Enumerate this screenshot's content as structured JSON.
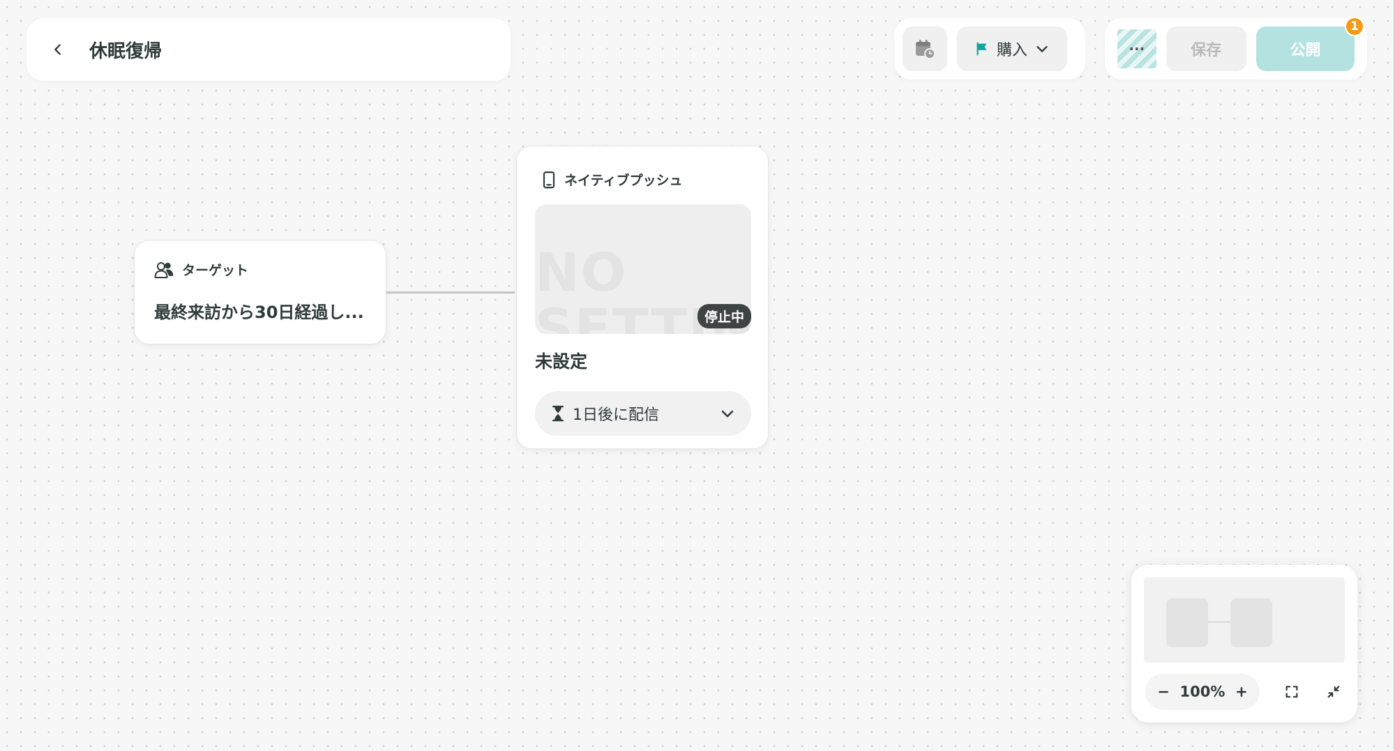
{
  "header": {
    "back_icon": "chevron-left-icon",
    "title": "休眠復帰"
  },
  "toolbar": {
    "schedule_icon": "calendar-clock-icon",
    "goal_icon": "flag-icon",
    "goal_label": "購入",
    "more_label": "···",
    "save_label": "保存",
    "publish_label": "公開",
    "notification_count": "1"
  },
  "target_node": {
    "icon": "users-icon",
    "label": "ターゲット",
    "condition": "最終来訪から30日経過し..."
  },
  "push_node": {
    "icon": "smartphone-icon",
    "label": "ネイティブプッシュ",
    "preview_watermark": "NO\nSETTING",
    "status": "停止中",
    "title": "未設定",
    "delivery_icon": "hourglass-icon",
    "delivery_label": "1日後に配信",
    "delivery_chevron": "chevron-down-icon"
  },
  "minimap": {
    "zoom_level": "100%",
    "zoom_out_label": "−",
    "zoom_in_label": "+"
  },
  "colors": {
    "accent": "#13a49d",
    "publish_disabled": "#b4e2e0",
    "badge": "#f59a15",
    "status_badge": "#3e4444"
  }
}
